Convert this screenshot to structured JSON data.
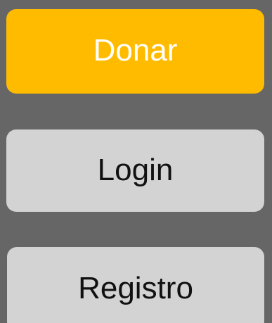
{
  "buttons": {
    "donar": {
      "label": "Donar",
      "color": "#ffbb00",
      "text_color": "#ffffff"
    },
    "login": {
      "label": "Login",
      "color": "#d3d3d3",
      "text_color": "#111111"
    },
    "registro": {
      "label": "Registro",
      "color": "#d3d3d3",
      "text_color": "#111111"
    }
  },
  "background_color": "#666666"
}
